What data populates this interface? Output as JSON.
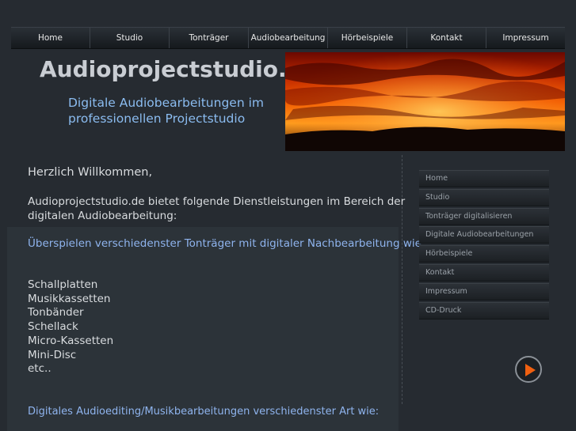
{
  "topnav": {
    "items": [
      {
        "label": "Home"
      },
      {
        "label": "Studio"
      },
      {
        "label": "Tonträger"
      },
      {
        "label": "Audiobearbeitung"
      },
      {
        "label": "Hörbeispiele"
      },
      {
        "label": "Kontakt"
      },
      {
        "label": "Impressum"
      }
    ]
  },
  "header": {
    "title": "Audioprojectstudio.de",
    "tagline": "Digitale Audiobearbeitungen im professionellen Projectstudio",
    "image_icon": "sunset-sky-image"
  },
  "main": {
    "greeting": "Herzlich Willkommen,",
    "intro": "Audioprojectstudio.de bietet folgende Dienstleistungen im Bereich der digitalen Audiobearbeitung:",
    "service_heading": "Überspielen verschiedenster Tonträger mit digitaler Nachbearbeitung wie:",
    "media": [
      "Schallplatten",
      "Musikkassetten",
      "Tonbänder",
      "Schellack",
      "Micro-Kassetten",
      "Mini-Disc",
      "etc.."
    ],
    "service_heading_2": "Digitales Audioediting/Musikbearbeitungen verschiedenster Art wie:"
  },
  "sidenav": {
    "items": [
      {
        "label": "Home"
      },
      {
        "label": "Studio"
      },
      {
        "label": "Tonträger digitalisieren"
      },
      {
        "label": "Digitale Audiobearbeitungen"
      },
      {
        "label": "Hörbeispiele"
      },
      {
        "label": "Kontakt"
      },
      {
        "label": "Impressum"
      },
      {
        "label": "CD-Druck"
      }
    ]
  },
  "player": {
    "icon": "play-icon",
    "accent_color": "#f06010"
  },
  "colors": {
    "background": "#262b31",
    "link_blue": "#8fb4ee",
    "tagline_blue": "#8bbcf0",
    "text": "#d9dcdf"
  }
}
